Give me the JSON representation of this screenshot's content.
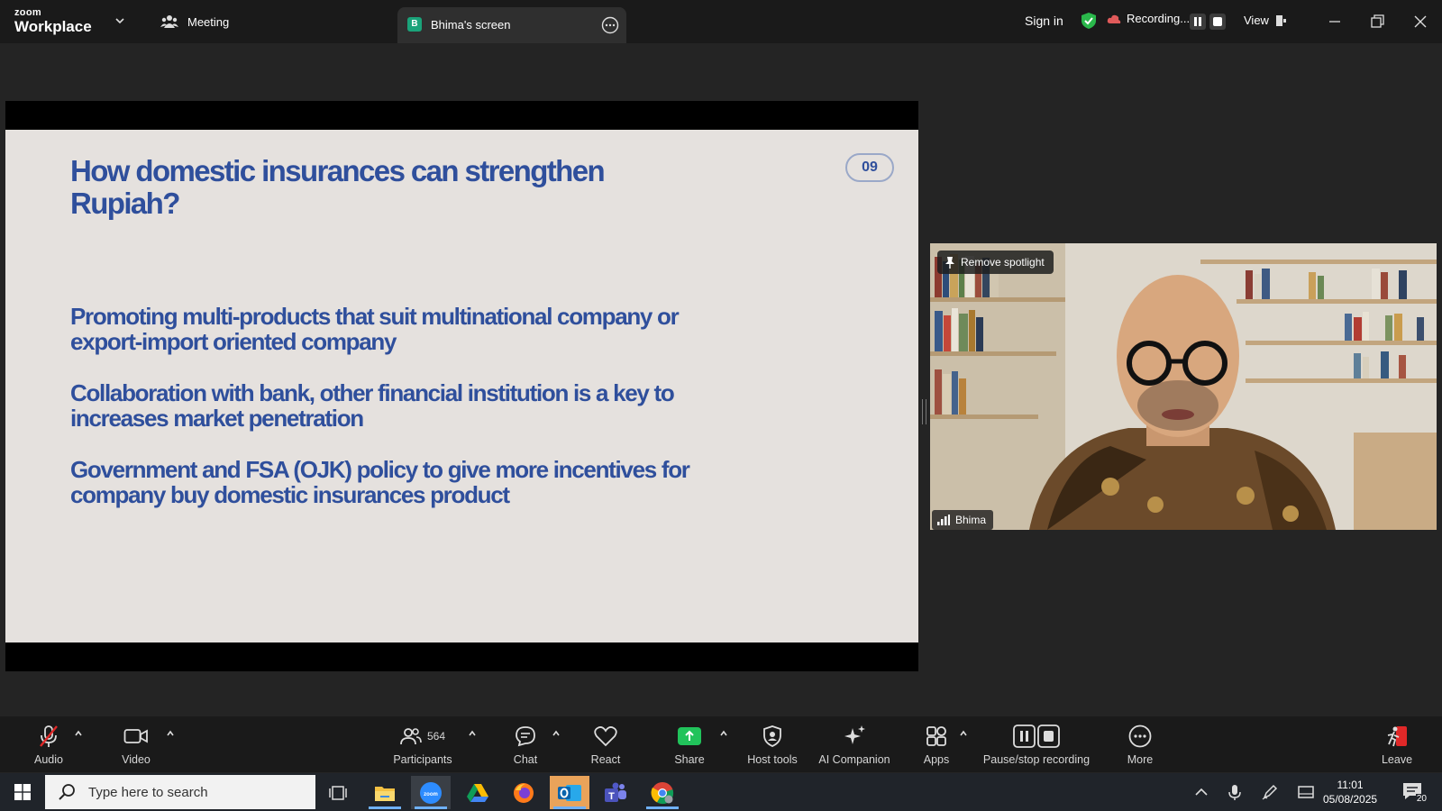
{
  "titlebar": {
    "logo_top": "zoom",
    "logo_bottom": "Workplace",
    "meeting_label": "Meeting",
    "active_tab": {
      "badge": "B",
      "label": "Bhima's screen"
    },
    "sign_in": "Sign in",
    "recording_label": "Recording...",
    "view_label": "View"
  },
  "slide": {
    "title": "How domestic insurances can strengthen Rupiah?",
    "number": "09",
    "bullets": [
      "Promoting multi-products that suit multinational company or export-import oriented company",
      "Collaboration with bank, other financial institution is a key to increases market penetration",
      "Government and FSA (OJK) policy to give more incentives for company buy domestic insurances product"
    ]
  },
  "video": {
    "spotlight_label": "Remove spotlight",
    "participant_name": "Bhima"
  },
  "toolbar": {
    "audio": "Audio",
    "video": "Video",
    "participants": "Participants",
    "participant_count": "564",
    "chat": "Chat",
    "react": "React",
    "share": "Share",
    "host_tools": "Host tools",
    "ai_companion": "AI Companion",
    "apps": "Apps",
    "pause_stop": "Pause/stop recording",
    "more": "More",
    "leave": "Leave"
  },
  "taskbar": {
    "search_placeholder": "Type here to search",
    "time": "11:01",
    "date": "05/08/2025",
    "notification_count": "20"
  },
  "colors": {
    "slide_text": "#2f4f9c",
    "share_green": "#21c35b",
    "recording_badge": "#1aa37a",
    "leave_red": "#e02828"
  }
}
